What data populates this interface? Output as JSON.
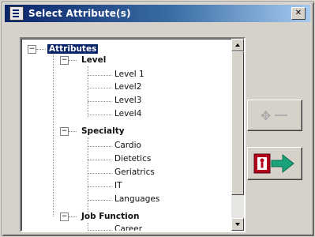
{
  "window": {
    "title": "Select Attribute(s)",
    "close_label": "✕"
  },
  "tree": {
    "root": "Attributes",
    "groups": [
      {
        "label": "Level",
        "children": [
          "Level 1",
          "Level2",
          "Level3",
          "Level4"
        ]
      },
      {
        "label": "Specialty",
        "children": [
          "Cardio",
          "Dietetics",
          "Geriatrics",
          "IT",
          "Languages"
        ]
      },
      {
        "label": "Job Function",
        "children": [
          "Career"
        ]
      }
    ],
    "expander_collapse": "−"
  },
  "buttons": {
    "add_glyph": "✥"
  },
  "colors": {
    "title_bar": "#0a246a",
    "selection": "#0a246a",
    "go_arrow": "#1aa37a",
    "exit_icon": "#b3001b"
  }
}
